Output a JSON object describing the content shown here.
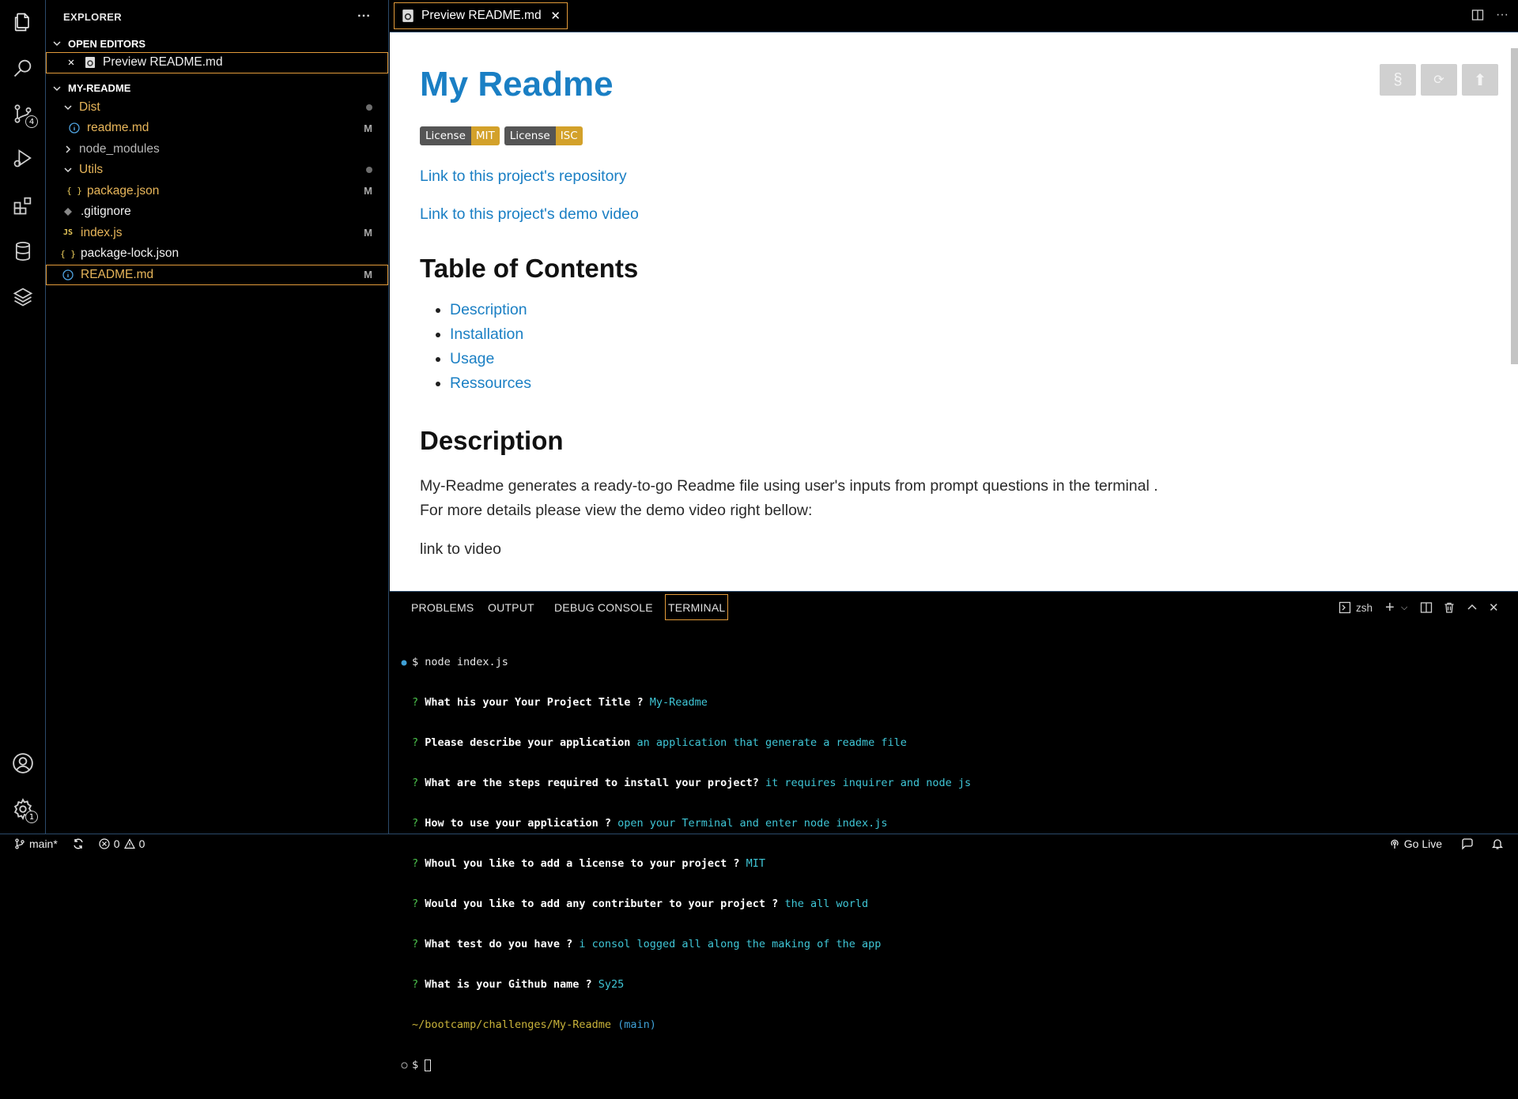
{
  "activity": {
    "scm_badge": "4",
    "settings_badge": "1"
  },
  "sidebar": {
    "title": "EXPLORER",
    "more": "···",
    "open_editors_label": "OPEN EDITORS",
    "open_editor_item": "Preview README.md",
    "project_label": "MY-README",
    "tree": [
      {
        "label": "Dist",
        "status": ""
      },
      {
        "label": "readme.md",
        "status": "M"
      },
      {
        "label": "node_modules",
        "status": ""
      },
      {
        "label": "Utils",
        "status": ""
      },
      {
        "label": "package.json",
        "status": "M"
      },
      {
        "label": ".gitignore",
        "status": ""
      },
      {
        "label": "index.js",
        "status": "M"
      },
      {
        "label": "package-lock.json",
        "status": ""
      },
      {
        "label": "README.md",
        "status": "M"
      }
    ]
  },
  "editor": {
    "tab_label": "Preview README.md"
  },
  "preview": {
    "title": "My Readme",
    "badges": [
      {
        "left": "License",
        "right": "MIT"
      },
      {
        "left": "License",
        "right": "ISC"
      }
    ],
    "repo_link": "Link to this project's repository",
    "video_link": "Link to this project's demo video",
    "toc_heading": "Table of Contents",
    "toc": [
      "Description",
      "Installation",
      "Usage",
      "Ressources"
    ],
    "desc_heading": "Description",
    "desc_line1": "My-Readme generates a ready-to-go Readme file using user's inputs from prompt questions in the terminal .",
    "desc_line2": "For more details please view the demo video right bellow:",
    "video_text": "link to video",
    "buttons": [
      "§",
      "⟳",
      "⬆"
    ]
  },
  "panel": {
    "tabs": [
      "PROBLEMS",
      "OUTPUT",
      "DEBUG CONSOLE",
      "TERMINAL"
    ],
    "shell": "zsh"
  },
  "terminal": {
    "command": "$ node index.js",
    "lines": [
      {
        "q": "What his your Your Project Title ?",
        "a": "My-Readme"
      },
      {
        "q": "Please describe your application",
        "a": "an application that generate a readme file"
      },
      {
        "q": "What are the steps required to install your project?",
        "a": "it requires inquirer and node js"
      },
      {
        "q": "How to use your application ?",
        "a": "open your Terminal and enter node index.js"
      },
      {
        "q": "Whoul you like to add a license to your project ?",
        "a": "MIT"
      },
      {
        "q": "Would you like to add any contributer to your project ?",
        "a": "the all world"
      },
      {
        "q": "What test do you have ?",
        "a": "i consol logged all along the making of the app"
      },
      {
        "q": "What is your Github name ?",
        "a": "Sy25"
      }
    ],
    "path": "~/bootcamp/challenges/My-Readme",
    "branch": "(main)",
    "prompt": "$"
  },
  "statusbar": {
    "branch": "main*",
    "errors": "0",
    "warnings": "0",
    "go_live": "Go Live"
  }
}
